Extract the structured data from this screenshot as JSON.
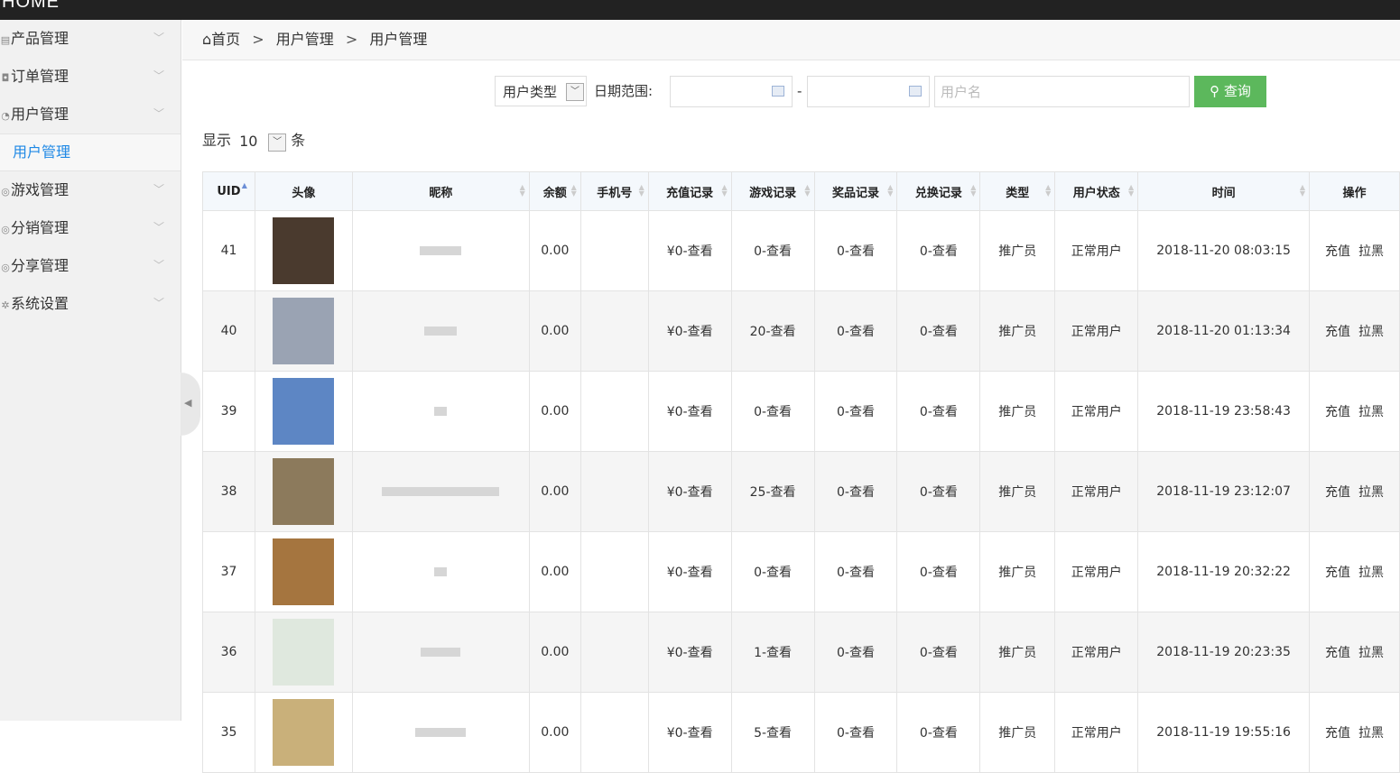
{
  "app": {
    "brand": "HOME"
  },
  "sidebar": {
    "items": [
      {
        "label": "产品管理",
        "icon": "grid-icon"
      },
      {
        "label": "订单管理",
        "icon": "cart-icon"
      },
      {
        "label": "用户管理",
        "icon": "user-icon"
      },
      {
        "label": "游戏管理",
        "icon": "gamepad-icon"
      },
      {
        "label": "分销管理",
        "icon": "share-icon"
      },
      {
        "label": "分享管理",
        "icon": "share-icon"
      },
      {
        "label": "系统设置",
        "icon": "gear-icon"
      }
    ],
    "active_sub": "用户管理"
  },
  "breadcrumb": {
    "home": "首页",
    "sep": ">",
    "level1": "用户管理",
    "level2": "用户管理"
  },
  "filters": {
    "user_type": "用户类型",
    "date_label": "日期范围:",
    "date_dash": "-",
    "username_placeholder": "用户名",
    "search_label": "查询"
  },
  "pagination": {
    "show": "显示",
    "page_size": "10",
    "unit": "条"
  },
  "table": {
    "columns": [
      "UID",
      "头像",
      "昵称",
      "余额",
      "手机号",
      "充值记录",
      "游戏记录",
      "奖品记录",
      "兑换记录",
      "类型",
      "用户状态",
      "时间",
      "操作"
    ],
    "rows": [
      {
        "uid": "41",
        "balance": "0.00",
        "phone": "",
        "recharge": "¥0-查看",
        "games": "0-查看",
        "prizes": "0-查看",
        "exchange": "0-查看",
        "type": "推广员",
        "status": "正常用户",
        "time": "2018-11-20 08:03:15",
        "action1": "充值",
        "action2": "拉黑",
        "avatar_color": "#4a3a2e",
        "nick_w": 46
      },
      {
        "uid": "40",
        "balance": "0.00",
        "phone": "",
        "recharge": "¥0-查看",
        "games": "20-查看",
        "prizes": "0-查看",
        "exchange": "0-查看",
        "type": "推广员",
        "status": "正常用户",
        "time": "2018-11-20 01:13:34",
        "action1": "充值",
        "action2": "拉黑",
        "avatar_color": "#9aa3b3",
        "nick_w": 36
      },
      {
        "uid": "39",
        "balance": "0.00",
        "phone": "",
        "recharge": "¥0-查看",
        "games": "0-查看",
        "prizes": "0-查看",
        "exchange": "0-查看",
        "type": "推广员",
        "status": "正常用户",
        "time": "2018-11-19 23:58:43",
        "action1": "充值",
        "action2": "拉黑",
        "avatar_color": "#5d86c4",
        "nick_w": 14
      },
      {
        "uid": "38",
        "balance": "0.00",
        "phone": "",
        "recharge": "¥0-查看",
        "games": "25-查看",
        "prizes": "0-查看",
        "exchange": "0-查看",
        "type": "推广员",
        "status": "正常用户",
        "time": "2018-11-19 23:12:07",
        "action1": "充值",
        "action2": "拉黑",
        "avatar_color": "#8c7a5c",
        "nick_w": 130
      },
      {
        "uid": "37",
        "balance": "0.00",
        "phone": "",
        "recharge": "¥0-查看",
        "games": "0-查看",
        "prizes": "0-查看",
        "exchange": "0-查看",
        "type": "推广员",
        "status": "正常用户",
        "time": "2018-11-19 20:32:22",
        "action1": "充值",
        "action2": "拉黑",
        "avatar_color": "#a5753f",
        "nick_w": 14
      },
      {
        "uid": "36",
        "balance": "0.00",
        "phone": "",
        "recharge": "¥0-查看",
        "games": "1-查看",
        "prizes": "0-查看",
        "exchange": "0-查看",
        "type": "推广员",
        "status": "正常用户",
        "time": "2018-11-19 20:23:35",
        "action1": "充值",
        "action2": "拉黑",
        "avatar_color": "#dfe8de",
        "nick_w": 44
      },
      {
        "uid": "35",
        "balance": "0.00",
        "phone": "",
        "recharge": "¥0-查看",
        "games": "5-查看",
        "prizes": "0-查看",
        "exchange": "0-查看",
        "type": "推广员",
        "status": "正常用户",
        "time": "2018-11-19 19:55:16",
        "action1": "充值",
        "action2": "拉黑",
        "avatar_color": "#c9b07a",
        "nick_w": 56
      }
    ]
  }
}
